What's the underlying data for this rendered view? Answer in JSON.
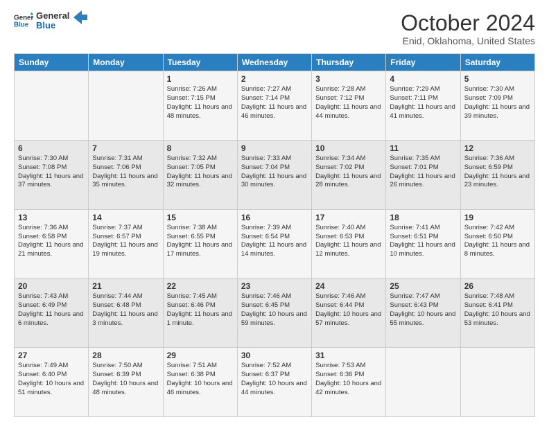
{
  "logo": {
    "line1": "General",
    "line2": "Blue"
  },
  "title": "October 2024",
  "subtitle": "Enid, Oklahoma, United States",
  "days_of_week": [
    "Sunday",
    "Monday",
    "Tuesday",
    "Wednesday",
    "Thursday",
    "Friday",
    "Saturday"
  ],
  "weeks": [
    [
      {
        "day": "",
        "info": ""
      },
      {
        "day": "",
        "info": ""
      },
      {
        "day": "1",
        "info": "Sunrise: 7:26 AM\nSunset: 7:15 PM\nDaylight: 11 hours and 48 minutes."
      },
      {
        "day": "2",
        "info": "Sunrise: 7:27 AM\nSunset: 7:14 PM\nDaylight: 11 hours and 46 minutes."
      },
      {
        "day": "3",
        "info": "Sunrise: 7:28 AM\nSunset: 7:12 PM\nDaylight: 11 hours and 44 minutes."
      },
      {
        "day": "4",
        "info": "Sunrise: 7:29 AM\nSunset: 7:11 PM\nDaylight: 11 hours and 41 minutes."
      },
      {
        "day": "5",
        "info": "Sunrise: 7:30 AM\nSunset: 7:09 PM\nDaylight: 11 hours and 39 minutes."
      }
    ],
    [
      {
        "day": "6",
        "info": "Sunrise: 7:30 AM\nSunset: 7:08 PM\nDaylight: 11 hours and 37 minutes."
      },
      {
        "day": "7",
        "info": "Sunrise: 7:31 AM\nSunset: 7:06 PM\nDaylight: 11 hours and 35 minutes."
      },
      {
        "day": "8",
        "info": "Sunrise: 7:32 AM\nSunset: 7:05 PM\nDaylight: 11 hours and 32 minutes."
      },
      {
        "day": "9",
        "info": "Sunrise: 7:33 AM\nSunset: 7:04 PM\nDaylight: 11 hours and 30 minutes."
      },
      {
        "day": "10",
        "info": "Sunrise: 7:34 AM\nSunset: 7:02 PM\nDaylight: 11 hours and 28 minutes."
      },
      {
        "day": "11",
        "info": "Sunrise: 7:35 AM\nSunset: 7:01 PM\nDaylight: 11 hours and 26 minutes."
      },
      {
        "day": "12",
        "info": "Sunrise: 7:36 AM\nSunset: 6:59 PM\nDaylight: 11 hours and 23 minutes."
      }
    ],
    [
      {
        "day": "13",
        "info": "Sunrise: 7:36 AM\nSunset: 6:58 PM\nDaylight: 11 hours and 21 minutes."
      },
      {
        "day": "14",
        "info": "Sunrise: 7:37 AM\nSunset: 6:57 PM\nDaylight: 11 hours and 19 minutes."
      },
      {
        "day": "15",
        "info": "Sunrise: 7:38 AM\nSunset: 6:55 PM\nDaylight: 11 hours and 17 minutes."
      },
      {
        "day": "16",
        "info": "Sunrise: 7:39 AM\nSunset: 6:54 PM\nDaylight: 11 hours and 14 minutes."
      },
      {
        "day": "17",
        "info": "Sunrise: 7:40 AM\nSunset: 6:53 PM\nDaylight: 11 hours and 12 minutes."
      },
      {
        "day": "18",
        "info": "Sunrise: 7:41 AM\nSunset: 6:51 PM\nDaylight: 11 hours and 10 minutes."
      },
      {
        "day": "19",
        "info": "Sunrise: 7:42 AM\nSunset: 6:50 PM\nDaylight: 11 hours and 8 minutes."
      }
    ],
    [
      {
        "day": "20",
        "info": "Sunrise: 7:43 AM\nSunset: 6:49 PM\nDaylight: 11 hours and 6 minutes."
      },
      {
        "day": "21",
        "info": "Sunrise: 7:44 AM\nSunset: 6:48 PM\nDaylight: 11 hours and 3 minutes."
      },
      {
        "day": "22",
        "info": "Sunrise: 7:45 AM\nSunset: 6:46 PM\nDaylight: 11 hours and 1 minute."
      },
      {
        "day": "23",
        "info": "Sunrise: 7:46 AM\nSunset: 6:45 PM\nDaylight: 10 hours and 59 minutes."
      },
      {
        "day": "24",
        "info": "Sunrise: 7:46 AM\nSunset: 6:44 PM\nDaylight: 10 hours and 57 minutes."
      },
      {
        "day": "25",
        "info": "Sunrise: 7:47 AM\nSunset: 6:43 PM\nDaylight: 10 hours and 55 minutes."
      },
      {
        "day": "26",
        "info": "Sunrise: 7:48 AM\nSunset: 6:41 PM\nDaylight: 10 hours and 53 minutes."
      }
    ],
    [
      {
        "day": "27",
        "info": "Sunrise: 7:49 AM\nSunset: 6:40 PM\nDaylight: 10 hours and 51 minutes."
      },
      {
        "day": "28",
        "info": "Sunrise: 7:50 AM\nSunset: 6:39 PM\nDaylight: 10 hours and 48 minutes."
      },
      {
        "day": "29",
        "info": "Sunrise: 7:51 AM\nSunset: 6:38 PM\nDaylight: 10 hours and 46 minutes."
      },
      {
        "day": "30",
        "info": "Sunrise: 7:52 AM\nSunset: 6:37 PM\nDaylight: 10 hours and 44 minutes."
      },
      {
        "day": "31",
        "info": "Sunrise: 7:53 AM\nSunset: 6:36 PM\nDaylight: 10 hours and 42 minutes."
      },
      {
        "day": "",
        "info": ""
      },
      {
        "day": "",
        "info": ""
      }
    ]
  ]
}
